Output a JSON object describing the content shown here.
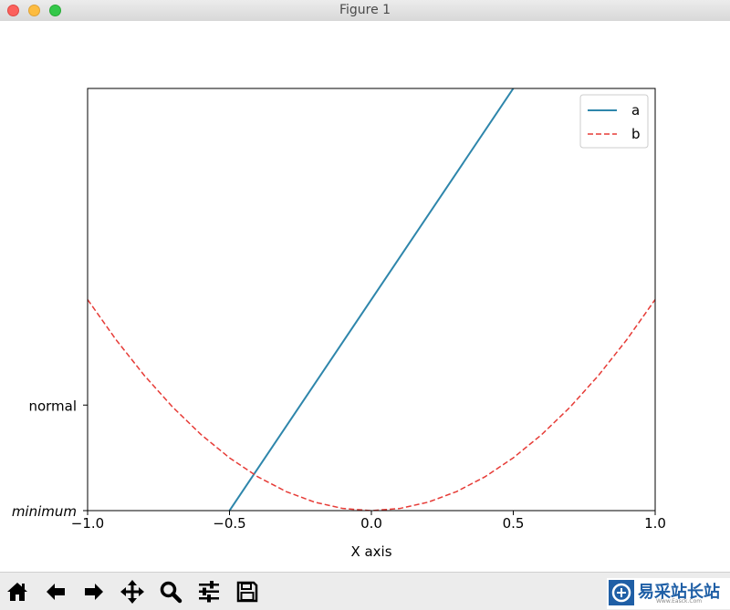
{
  "window": {
    "title": "Figure 1"
  },
  "chart_data": {
    "type": "line",
    "xlabel": "X axis",
    "ylabel": "",
    "xlim": [
      -1.0,
      1.0
    ],
    "ylim": [
      -2.0,
      6.0
    ],
    "xticks": [
      -1.0,
      -0.5,
      0.0,
      0.5,
      1.0
    ],
    "xtick_labels": [
      "−1.0",
      "−0.5",
      "0.0",
      "0.5",
      "1.0"
    ],
    "yticks": [
      -2,
      0
    ],
    "ytick_labels": [
      "minimum",
      "normal"
    ],
    "grid": false,
    "legend": "upper right",
    "series": [
      {
        "name": "a",
        "color": "#2e86ab",
        "style": "solid",
        "x": [
          -0.5,
          0.5
        ],
        "y": [
          -2.0,
          6.0
        ]
      },
      {
        "name": "b",
        "color": "#e63b36",
        "style": "dashed",
        "x": [
          -1.0,
          -0.9,
          -0.8,
          -0.7,
          -0.6,
          -0.5,
          -0.4,
          -0.3,
          -0.2,
          -0.1,
          0.0,
          0.1,
          0.2,
          0.3,
          0.4,
          0.5,
          0.6,
          0.7,
          0.8,
          0.9,
          1.0
        ],
        "y": [
          2.0,
          1.24,
          0.56,
          -0.04,
          -0.56,
          -1.0,
          -1.36,
          -1.64,
          -1.84,
          -1.96,
          -2.0,
          -1.96,
          -1.84,
          -1.64,
          -1.36,
          -1.0,
          -0.56,
          -0.04,
          0.56,
          1.24,
          2.0
        ]
      }
    ]
  },
  "toolbar": {
    "buttons": [
      {
        "name": "home-button",
        "icon": "home-icon"
      },
      {
        "name": "back-button",
        "icon": "arrow-left-icon"
      },
      {
        "name": "forward-button",
        "icon": "arrow-right-icon"
      },
      {
        "name": "pan-button",
        "icon": "move-icon"
      },
      {
        "name": "zoom-button",
        "icon": "magnifier-icon"
      },
      {
        "name": "configure-subplots-button",
        "icon": "sliders-icon"
      },
      {
        "name": "save-button",
        "icon": "floppy-disk-icon"
      }
    ]
  },
  "watermark": {
    "text": "易采站长站",
    "sub": "Www.Easck.Com"
  }
}
